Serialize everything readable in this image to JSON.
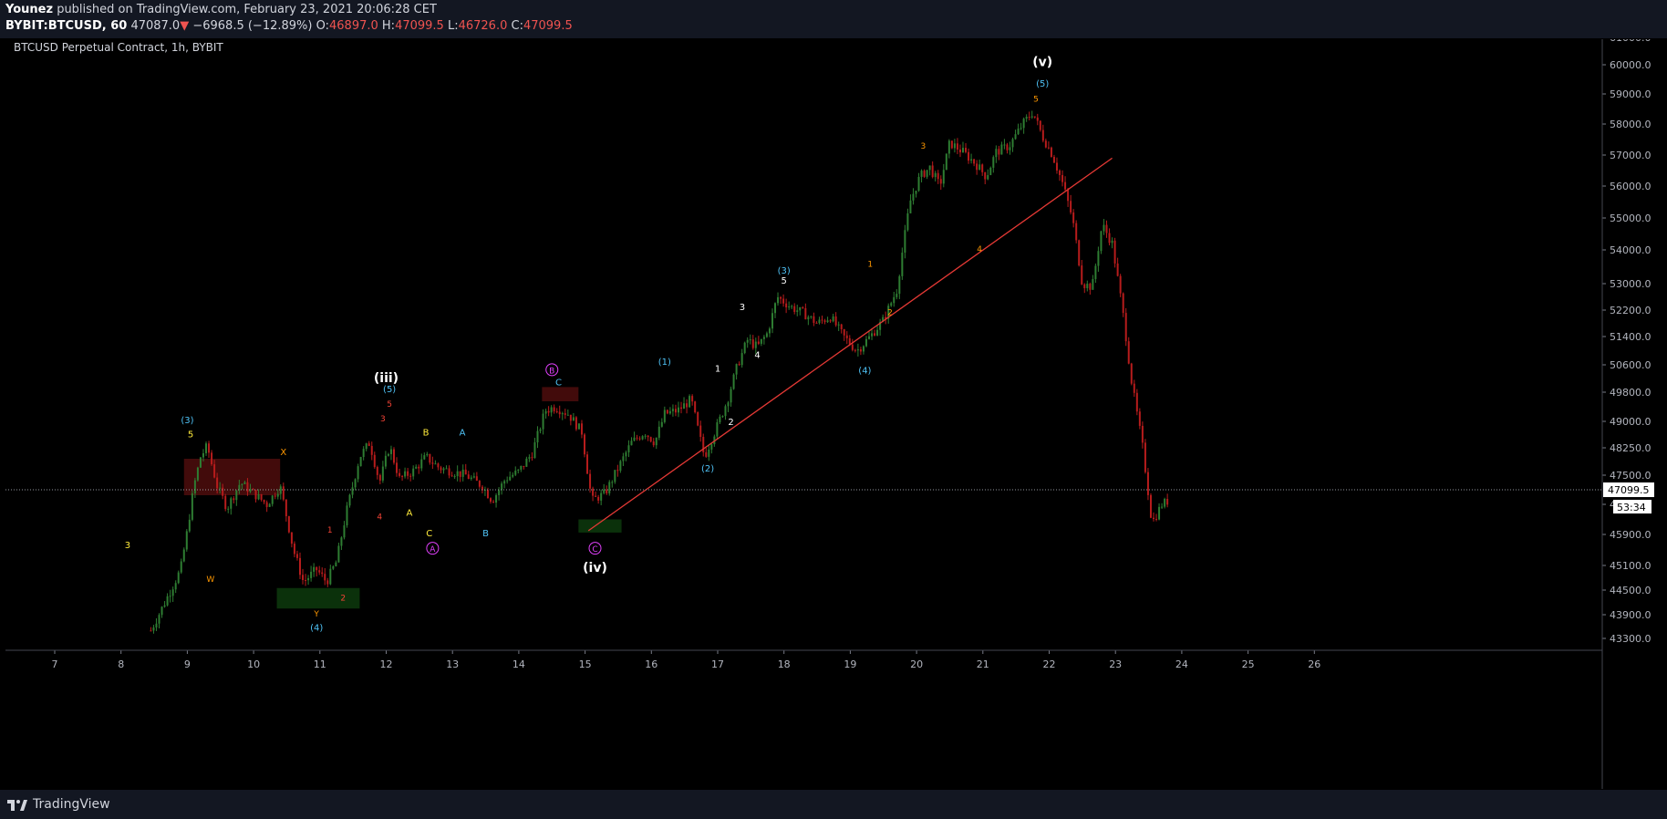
{
  "header": {
    "author": "Younez",
    "published": "published on TradingView.com, February 23, 2021 20:06:28 CET",
    "symbol": "BYBIT:BTCUSD, 60",
    "last": "47087.0",
    "change": "−6968.5 (−12.89%)",
    "o_label": "O:",
    "o": "46897.0",
    "h_label": "H:",
    "h": "47099.5",
    "l_label": "L:",
    "l": "46726.0",
    "c_label": "C:",
    "c": "47099.5"
  },
  "chart_title": "BTCUSD Perpetual Contract, 1h, BYBIT",
  "footer": {
    "brand": "TradingView"
  },
  "colors": {
    "up": "#26a69a",
    "down": "#ef5350",
    "candle_up": "#2e7d32",
    "candle_down": "#b71c1c",
    "trendline": "#e53935",
    "cyan": "#4fc3f7",
    "yellow": "#ffeb3b",
    "orange": "#ff9800",
    "red": "#f44336",
    "magenta": "#e040fb",
    "white": "#ffffff"
  },
  "chart_data": {
    "type": "candlestick",
    "title": "BTCUSD Perpetual Contract, 1h, BYBIT",
    "x_ticks": [
      "7",
      "8",
      "9",
      "10",
      "11",
      "12",
      "13",
      "14",
      "15",
      "16",
      "17",
      "18",
      "19",
      "20",
      "21",
      "22",
      "23",
      "24",
      "25",
      "26"
    ],
    "y_ticks": [
      "61000.0",
      "60000.0",
      "59000.0",
      "58000.0",
      "57000.0",
      "56000.0",
      "55000.0",
      "54000.0",
      "53000.0",
      "52200.0",
      "51400.0",
      "50600.0",
      "49800.0",
      "49000.0",
      "48250.0",
      "47500.0",
      "46700.0",
      "45900.0",
      "45100.0",
      "44500.0",
      "43900.0",
      "43300.0"
    ],
    "ylim": [
      43000,
      61200
    ],
    "last_price": "47099.5",
    "countdown": "53:34",
    "path_x": [
      8.45,
      8.6,
      8.75,
      8.9,
      9.0,
      9.1,
      9.2,
      9.3,
      9.45,
      9.6,
      9.8,
      10.0,
      10.2,
      10.4,
      10.6,
      10.75,
      10.95,
      11.1,
      11.25,
      11.4,
      11.6,
      11.75,
      11.9,
      12.05,
      12.2,
      12.4,
      12.6,
      12.8,
      13.0,
      13.2,
      13.45,
      13.6,
      13.8,
      14.0,
      14.2,
      14.4,
      14.55,
      14.75,
      14.95,
      15.1,
      15.3,
      15.5,
      15.7,
      15.9,
      16.05,
      16.2,
      16.4,
      16.6,
      16.8,
      17.0,
      17.15,
      17.3,
      17.45,
      17.6,
      17.75,
      17.9,
      18.1,
      18.3,
      18.5,
      18.7,
      18.9,
      19.1,
      19.3,
      19.5,
      19.7,
      19.9,
      20.05,
      20.2,
      20.35,
      20.5,
      20.7,
      20.9,
      21.05,
      21.2,
      21.4,
      21.6,
      21.75,
      21.9,
      22.05,
      22.2,
      22.35,
      22.5,
      22.65,
      22.8,
      22.95,
      23.1,
      23.25,
      23.4,
      23.55,
      23.7,
      23.8
    ],
    "path_y": [
      43500,
      44000,
      44500,
      45000,
      46000,
      47200,
      48000,
      48300,
      47200,
      46600,
      47300,
      47000,
      46700,
      47200,
      45500,
      44700,
      45000,
      44700,
      45200,
      46500,
      48000,
      48400,
      47300,
      48300,
      47400,
      47600,
      48000,
      47700,
      47600,
      47500,
      47200,
      46800,
      47400,
      47600,
      48100,
      49300,
      49400,
      49200,
      48700,
      46800,
      47000,
      47700,
      48400,
      48700,
      48400,
      49200,
      49300,
      49600,
      48000,
      48900,
      49600,
      50600,
      51300,
      51100,
      51500,
      52600,
      52300,
      52100,
      51800,
      52000,
      51400,
      51000,
      51400,
      51900,
      52800,
      55500,
      56300,
      56600,
      56000,
      57400,
      57100,
      56700,
      56300,
      57100,
      57300,
      58000,
      58400,
      57600,
      57000,
      56100,
      55000,
      53000,
      52900,
      54800,
      54200,
      52300,
      50000,
      48400,
      46200,
      46700,
      46800
    ],
    "trendline": {
      "x1": 15.05,
      "y1": 46000,
      "x2": 22.95,
      "y2": 56900
    },
    "zones": [
      {
        "type": "supply",
        "x1": 8.95,
        "x2": 10.4,
        "y1": 47950,
        "y2": 46950
      },
      {
        "type": "demand",
        "x1": 10.35,
        "x2": 11.6,
        "y1": 44550,
        "y2": 44050
      },
      {
        "type": "supply",
        "x1": 14.35,
        "x2": 14.9,
        "y1": 49950,
        "y2": 49550
      },
      {
        "type": "demand",
        "x1": 14.9,
        "x2": 15.55,
        "y1": 46300,
        "y2": 45950
      }
    ],
    "annotations": [
      {
        "text": "3",
        "x": 8.1,
        "y": 45550,
        "color": "yellow",
        "size": 10
      },
      {
        "text": "(3)",
        "x": 9.0,
        "y": 48950,
        "color": "cyan",
        "size": 10
      },
      {
        "text": "5",
        "x": 9.05,
        "y": 48550,
        "color": "yellow",
        "size": 10
      },
      {
        "text": "W",
        "x": 9.35,
        "y": 44700,
        "color": "orange",
        "size": 9
      },
      {
        "text": "X",
        "x": 10.45,
        "y": 48050,
        "color": "orange",
        "size": 10
      },
      {
        "text": "1",
        "x": 11.15,
        "y": 45950,
        "color": "red",
        "size": 9
      },
      {
        "text": "2",
        "x": 11.35,
        "y": 44250,
        "color": "red",
        "size": 9
      },
      {
        "text": "Y",
        "x": 10.95,
        "y": 43850,
        "color": "orange",
        "size": 9
      },
      {
        "text": "(4)",
        "x": 10.95,
        "y": 43500,
        "color": "cyan",
        "size": 10
      },
      {
        "text": "3",
        "x": 11.95,
        "y": 49000,
        "color": "red",
        "size": 9
      },
      {
        "text": "4",
        "x": 11.9,
        "y": 46300,
        "color": "red",
        "size": 9
      },
      {
        "text": "(iii)",
        "x": 12.0,
        "y": 50100,
        "color": "white",
        "size": 14
      },
      {
        "text": "(5)",
        "x": 12.05,
        "y": 49800,
        "color": "cyan",
        "size": 10
      },
      {
        "text": "5",
        "x": 12.05,
        "y": 49400,
        "color": "red",
        "size": 9
      },
      {
        "text": "B",
        "x": 12.6,
        "y": 48600,
        "color": "yellow",
        "size": 10
      },
      {
        "text": "A",
        "x": 12.35,
        "y": 46400,
        "color": "yellow",
        "size": 10
      },
      {
        "text": "C",
        "x": 12.65,
        "y": 45850,
        "color": "yellow",
        "size": 10
      },
      {
        "text": "A",
        "x": 13.15,
        "y": 48600,
        "color": "cyan",
        "size": 10
      },
      {
        "text": "B",
        "x": 13.5,
        "y": 45850,
        "color": "cyan",
        "size": 10
      },
      {
        "text": "C",
        "x": 14.6,
        "y": 50000,
        "color": "cyan",
        "size": 10
      },
      {
        "text": "(1)",
        "x": 16.2,
        "y": 50600,
        "color": "cyan",
        "size": 10
      },
      {
        "text": "(2)",
        "x": 16.85,
        "y": 47600,
        "color": "cyan",
        "size": 10
      },
      {
        "text": "1",
        "x": 17.0,
        "y": 50400,
        "color": "white",
        "size": 10
      },
      {
        "text": "2",
        "x": 17.2,
        "y": 48900,
        "color": "white",
        "size": 10
      },
      {
        "text": "3",
        "x": 17.37,
        "y": 52200,
        "color": "white",
        "size": 10
      },
      {
        "text": "4",
        "x": 17.6,
        "y": 50800,
        "color": "white",
        "size": 10
      },
      {
        "text": "(3)",
        "x": 18.0,
        "y": 53300,
        "color": "cyan",
        "size": 10
      },
      {
        "text": "5",
        "x": 18.0,
        "y": 53000,
        "color": "white",
        "size": 10
      },
      {
        "text": "1",
        "x": 19.3,
        "y": 53500,
        "color": "orange",
        "size": 9
      },
      {
        "text": "2",
        "x": 19.6,
        "y": 52050,
        "color": "orange",
        "size": 9
      },
      {
        "text": "(4)",
        "x": 19.22,
        "y": 50350,
        "color": "cyan",
        "size": 10
      },
      {
        "text": "3",
        "x": 20.1,
        "y": 57200,
        "color": "orange",
        "size": 9
      },
      {
        "text": "4",
        "x": 20.95,
        "y": 53950,
        "color": "orange",
        "size": 9
      },
      {
        "text": "5",
        "x": 21.8,
        "y": 58750,
        "color": "orange",
        "size": 9
      },
      {
        "text": "(5)",
        "x": 21.9,
        "y": 59250,
        "color": "cyan",
        "size": 10
      },
      {
        "text": "(v)",
        "x": 21.9,
        "y": 59950,
        "color": "white",
        "size": 14
      },
      {
        "text": "(iv)",
        "x": 15.15,
        "y": 44950,
        "color": "white",
        "size": 14
      }
    ],
    "circled": [
      {
        "text": "A",
        "x": 12.7,
        "y": 45450,
        "color": "magenta"
      },
      {
        "text": "B",
        "x": 14.5,
        "y": 50350,
        "color": "magenta"
      },
      {
        "text": "C",
        "x": 15.15,
        "y": 45450,
        "color": "magenta"
      }
    ]
  }
}
